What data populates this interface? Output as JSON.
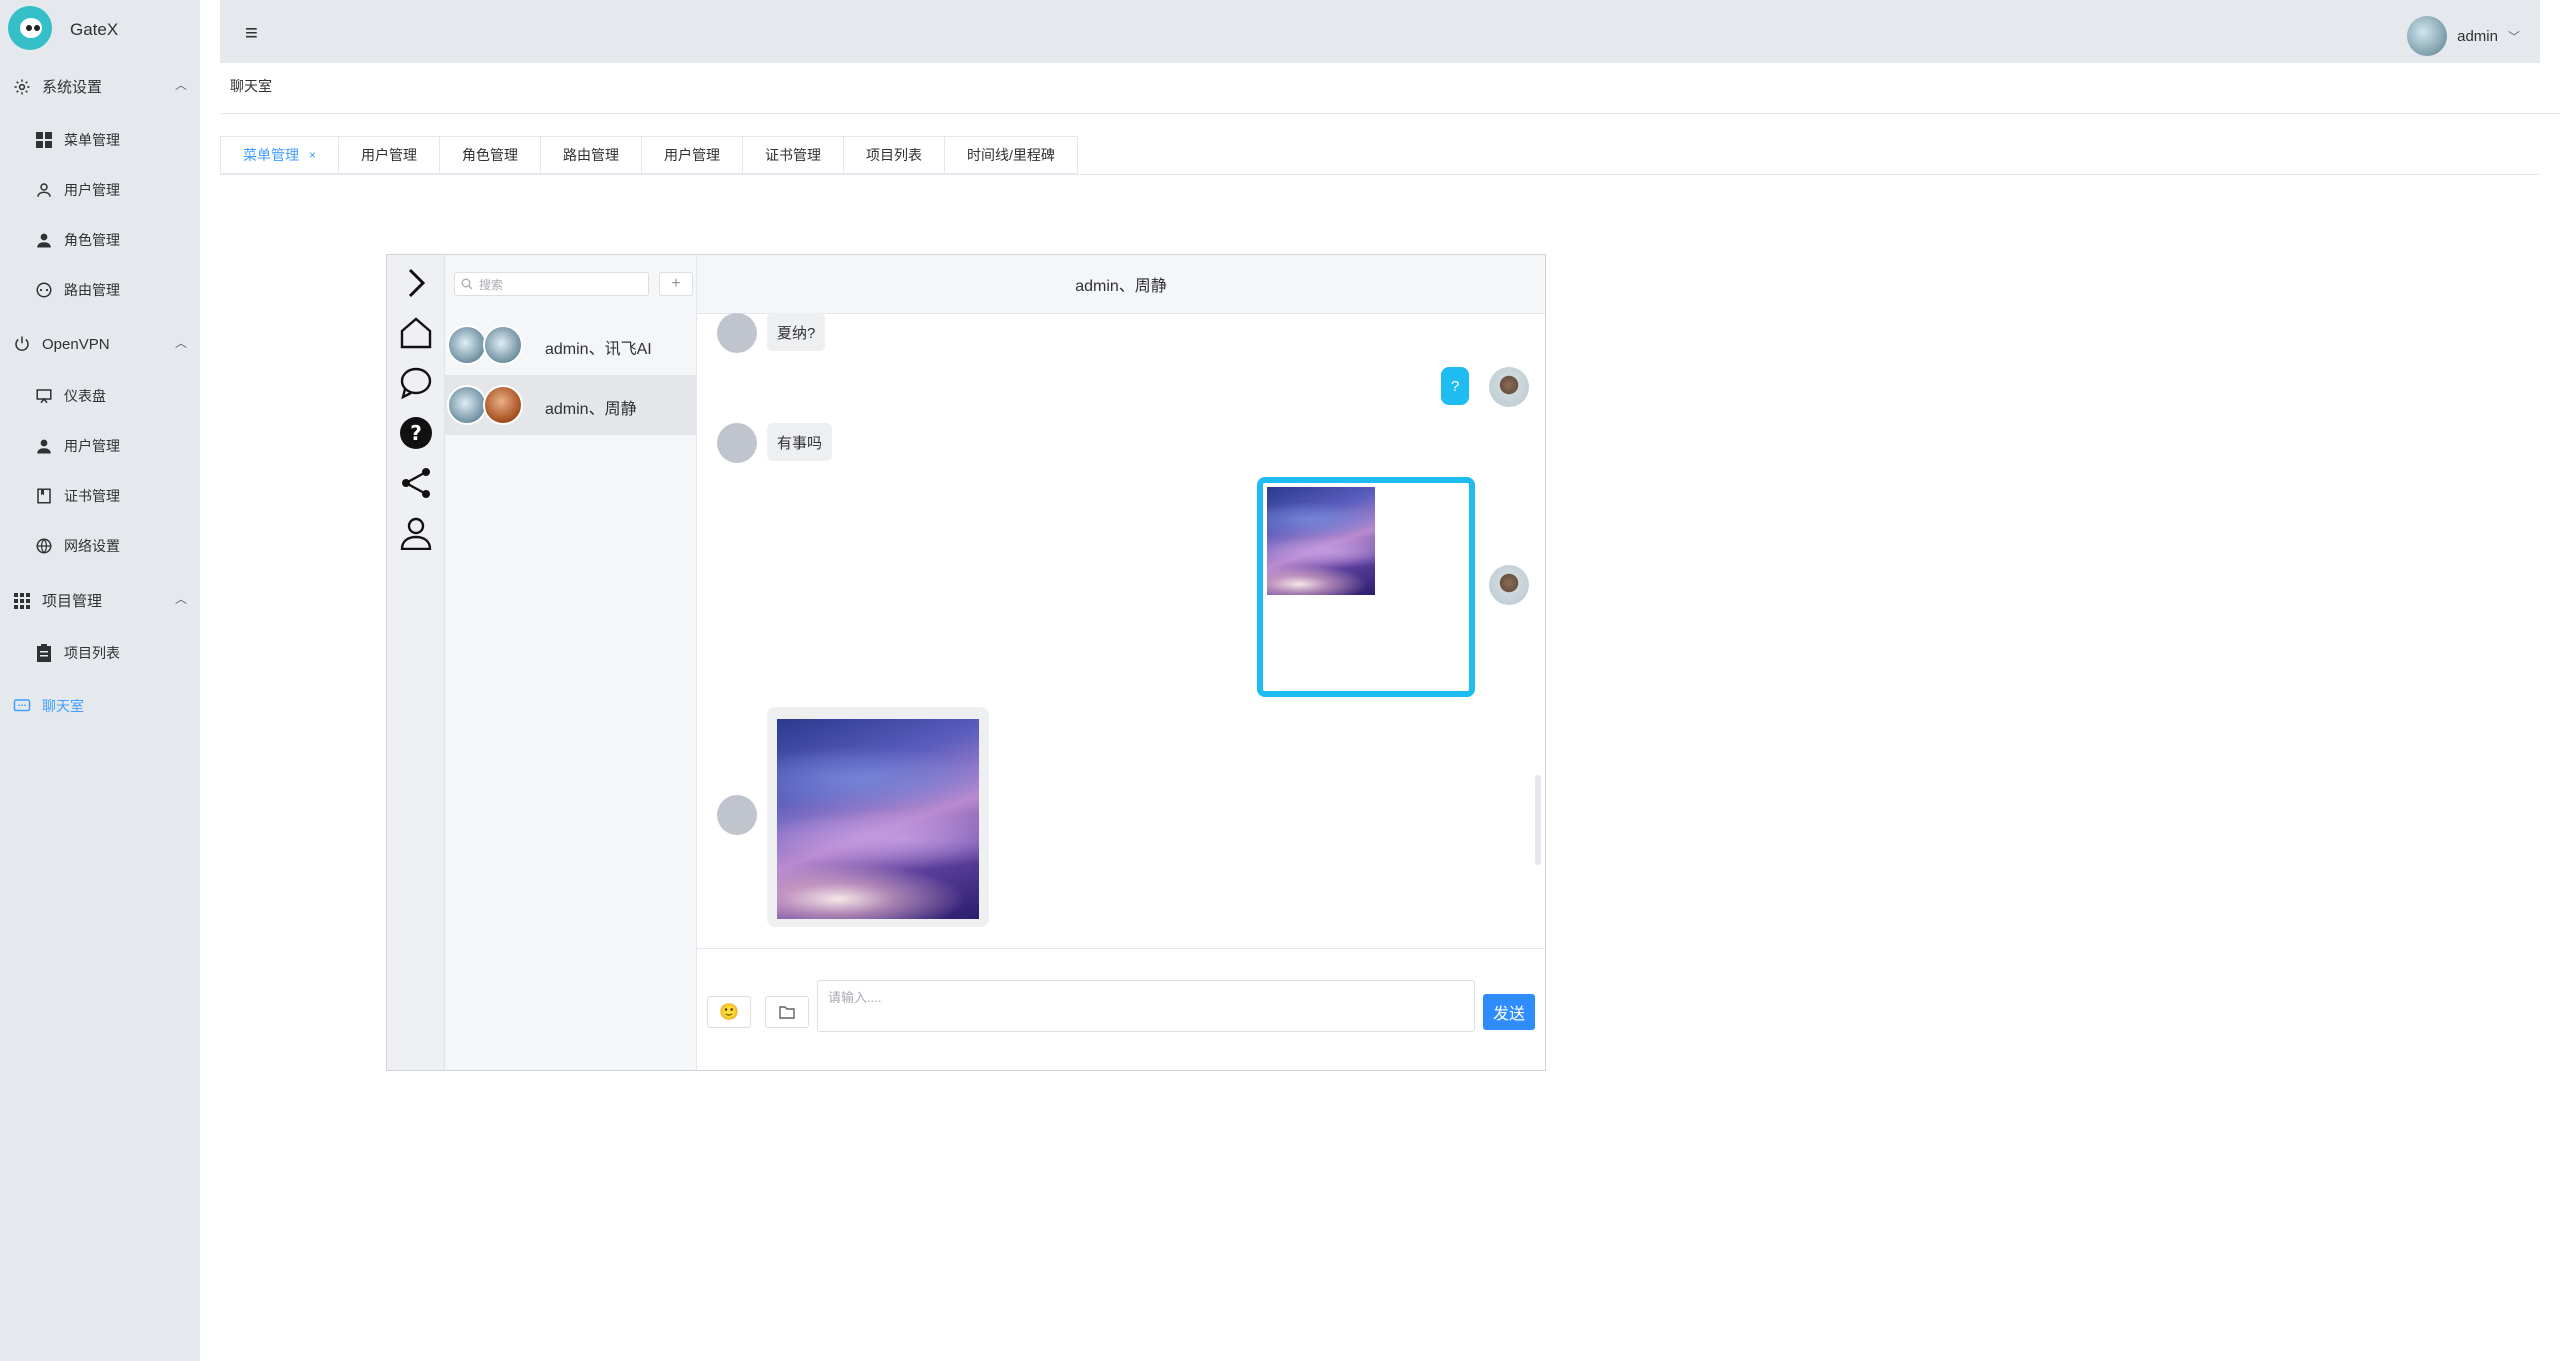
{
  "app": {
    "brand": "GateX"
  },
  "sidebar": {
    "groups": [
      {
        "label": "系统设置",
        "items": [
          {
            "label": "菜单管理"
          },
          {
            "label": "用户管理"
          },
          {
            "label": "角色管理"
          },
          {
            "label": "路由管理"
          }
        ]
      },
      {
        "label": "OpenVPN",
        "items": [
          {
            "label": "仪表盘"
          },
          {
            "label": "用户管理"
          },
          {
            "label": "证书管理"
          },
          {
            "label": "网络设置"
          }
        ]
      },
      {
        "label": "项目管理",
        "items": [
          {
            "label": "项目列表"
          }
        ]
      }
    ],
    "chat_link": "聊天室"
  },
  "header": {
    "username": "admin"
  },
  "breadcrumb": "聊天室",
  "tabs": [
    {
      "label": "菜单管理",
      "active": true
    },
    {
      "label": "用户管理"
    },
    {
      "label": "角色管理"
    },
    {
      "label": "路由管理"
    },
    {
      "label": "用户管理"
    },
    {
      "label": "证书管理"
    },
    {
      "label": "项目列表"
    },
    {
      "label": "时间线/里程碑"
    }
  ],
  "chat": {
    "search_placeholder": "搜索",
    "add_label": "+",
    "conversations": [
      {
        "name": "admin、讯飞AI"
      },
      {
        "name": "admin、周静",
        "selected": true
      }
    ],
    "title": "admin、周静",
    "messages": [
      {
        "from": "other",
        "text": "夏纳?"
      },
      {
        "from": "me",
        "text": "?"
      },
      {
        "from": "other",
        "text": "有事吗"
      },
      {
        "from": "me",
        "type": "image"
      },
      {
        "from": "other",
        "type": "image"
      }
    ],
    "input_placeholder": "请输入....",
    "send_label": "发送",
    "emoji": "🙂",
    "colors": {
      "accent": "#409eff",
      "bubble_me": "#1ebcf0",
      "send": "#2f8cff"
    }
  }
}
